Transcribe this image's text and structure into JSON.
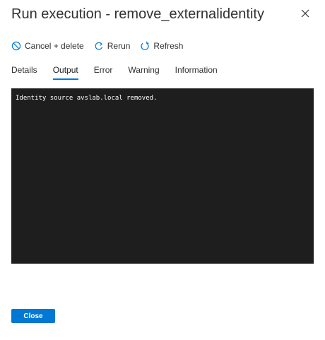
{
  "panel": {
    "title": "Run execution - remove_externalidentity"
  },
  "toolbar": {
    "cancel_delete_label": "Cancel + delete",
    "rerun_label": "Rerun",
    "refresh_label": "Refresh"
  },
  "tabs": [
    {
      "label": "Details",
      "active": false
    },
    {
      "label": "Output",
      "active": true
    },
    {
      "label": "Error",
      "active": false
    },
    {
      "label": "Warning",
      "active": false
    },
    {
      "label": "Information",
      "active": false
    }
  ],
  "output": {
    "lines": [
      "Identity source avslab.local removed."
    ]
  },
  "footer": {
    "close_label": "Close"
  },
  "colors": {
    "accent": "#0078d4",
    "console_background": "#1e1e1e",
    "console_text": "#ffffff"
  }
}
